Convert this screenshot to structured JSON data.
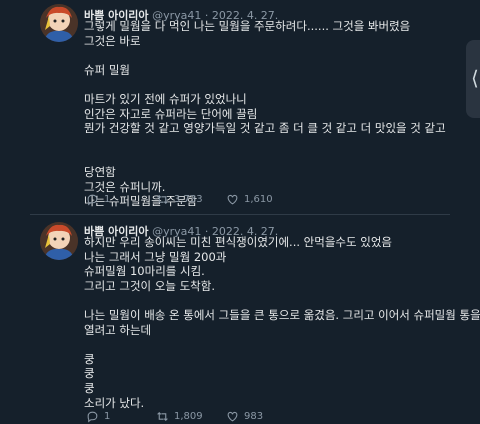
{
  "tweets": [
    {
      "name": "바쁨 아이리아",
      "meta": "@yrya41 · 2022. 4. 27.",
      "lines": [
        "그렇게 밀웜을 다 먹인 나는 밀웜을 주문하려다...... 그것을 봐버렸음",
        "그것은 바로",
        "",
        "슈퍼 밀웜",
        "",
        "마트가 있기 전에 슈퍼가 있었나니",
        "인간은 자고로 슈퍼라는 단어에 끌림",
        "뭔가 건강할 것 같고 영양가득일 것 같고 좀 더 클 것 같고 더 맛있을 것 같고",
        "",
        "",
        "당연함",
        "그것은 슈퍼니까.",
        "나는 슈퍼밀웜을 주문함"
      ],
      "stats": {
        "replies": "1",
        "retweets": "3,733",
        "likes": "1,610"
      }
    },
    {
      "name": "바쁨 아이리아",
      "meta": "@yrya41 · 2022. 4. 27.",
      "lines": [
        "하지만 우리 송이씨는 미친 편식쟁이였기에... 안먹을수도 있었음",
        "나는 그래서 그냥 밀웜 200과",
        "슈퍼밀웜 10마리를 시킴.",
        "그리고 그것이 오늘 도착함.",
        "",
        "나는 밀웜이 배송 온 통에서 그들을 큰 통으로 옮겼음. 그리고 이어서 슈퍼밀웜 통을",
        "열려고 하는데",
        "",
        "쿵",
        "쿵",
        "쿵",
        "소리가 났다."
      ],
      "stats": {
        "replies": "1",
        "retweets": "1,809",
        "likes": "983"
      }
    }
  ],
  "side_handle_glyph": "⟨"
}
